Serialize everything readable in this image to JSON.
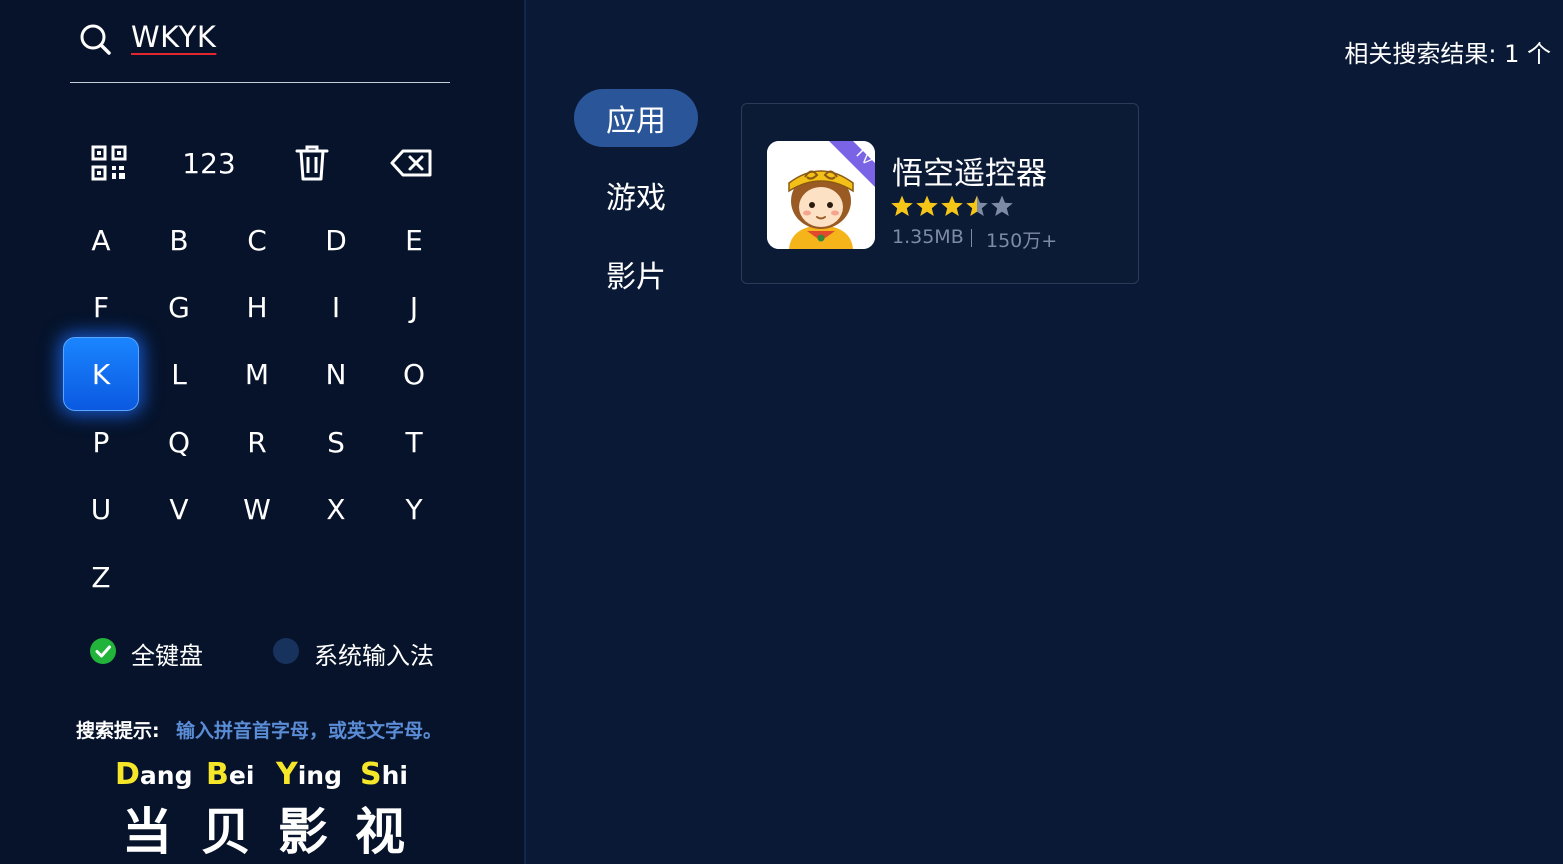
{
  "search": {
    "query": "WKYK"
  },
  "toolbar": {
    "qr_icon": "qr-code-icon",
    "numeric_label": "123",
    "clear_icon": "trash-icon",
    "backspace_icon": "backspace-icon"
  },
  "keyboard": {
    "keys": [
      "A",
      "B",
      "C",
      "D",
      "E",
      "F",
      "G",
      "H",
      "I",
      "J",
      "K",
      "L",
      "M",
      "N",
      "O",
      "P",
      "Q",
      "R",
      "S",
      "T",
      "U",
      "V",
      "W",
      "X",
      "Y",
      "Z"
    ],
    "focused_key": "K"
  },
  "input_mode": {
    "options": [
      {
        "label": "全键盘",
        "selected": true
      },
      {
        "label": "系统输入法",
        "selected": false
      }
    ]
  },
  "hint": {
    "label": "搜索提示:",
    "text": "输入拼音首字母，或英文字母。"
  },
  "brand": {
    "pinyin": [
      {
        "cap": "D",
        "rest": "ang"
      },
      {
        "cap": "B",
        "rest": "ei"
      },
      {
        "cap": "Y",
        "rest": "ing"
      },
      {
        "cap": "S",
        "rest": "hi"
      }
    ],
    "chars": [
      "当",
      "贝",
      "影",
      "视"
    ]
  },
  "results": {
    "count_text": "相关搜索结果: 1 个"
  },
  "categories": [
    {
      "label": "应用",
      "active": true
    },
    {
      "label": "游戏",
      "active": false
    },
    {
      "label": "影片",
      "active": false
    }
  ],
  "apps": [
    {
      "name": "悟空遥控器",
      "badge": "TV",
      "rating": 3.5,
      "max_rating": 5,
      "size": "1.35MB",
      "downloads": "150万+"
    }
  ],
  "colors": {
    "background": "#0a1a36",
    "left_panel": "#06132a",
    "focus_key": "#0b6cf0",
    "active_tab": "#2a5599",
    "check_green": "#21b33a",
    "star_gold": "#f5c518",
    "brand_yellow": "#f6e62a",
    "hint_blue": "#5b8cd6"
  }
}
